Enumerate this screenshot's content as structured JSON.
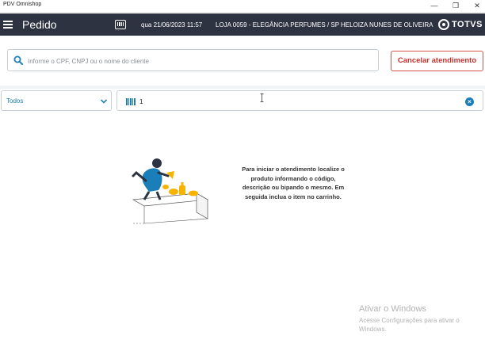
{
  "window": {
    "title": "PDV Omnishop",
    "minimize_glyph": "—",
    "restore_glyph": "❐",
    "close_glyph": "✕"
  },
  "header": {
    "title": "Pedido",
    "datetime": "qua 21/06/2023 11:57",
    "store": "LOJA 0059 - ELEGÂNCIA PERFUMES / SP",
    "user": "HELOIZA NUNES DE OLIVEIRA",
    "brand": "TOTVS",
    "menu_icon": "menu-icon",
    "barcode_icon": "barcode-icon",
    "colors": {
      "bar": "#2d3340",
      "text": "#ffffff"
    }
  },
  "customer_search": {
    "placeholder": "Informe o CPF, CNPJ ou o nome do cliente",
    "value": "",
    "icon": "search-icon"
  },
  "cancel_button": {
    "label": "Cancelar atendimento",
    "color": "#c9302c"
  },
  "filter": {
    "selected": "Todos",
    "icon": "chevron-down-icon"
  },
  "product_search": {
    "value": "1",
    "icon": "barcode-icon",
    "clear_icon": "close-circle-icon",
    "accent": "#1a7fb8"
  },
  "empty_state": {
    "message": "Para iniciar o atendimento localize o produto informando o código, descrição ou bipando o mesmo. Em seguida inclua o item no carrinho.",
    "illustration": "person-scanning-products-illustration"
  },
  "watermark": {
    "title": "Ativar o Windows",
    "subtitle": "Acesse Configurações para ativar o Windows."
  }
}
